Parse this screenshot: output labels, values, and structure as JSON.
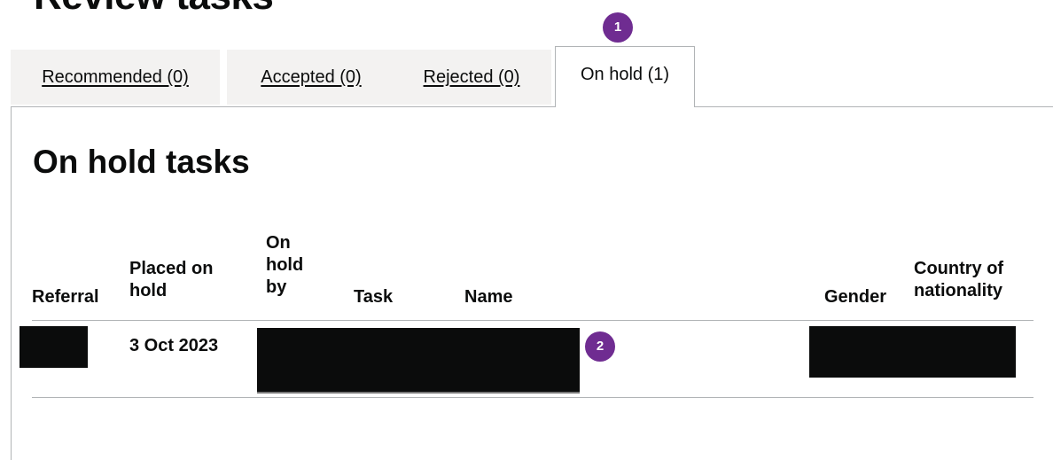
{
  "page": {
    "heading": "Review tasks"
  },
  "tabs": [
    {
      "label": "Recommended (0)",
      "selected": false
    },
    {
      "label": "Accepted (0)",
      "selected": false
    },
    {
      "label": "Rejected (0)",
      "selected": false
    },
    {
      "label": "On hold (1)",
      "selected": true
    }
  ],
  "callouts": {
    "one": "1",
    "two": "2"
  },
  "panel": {
    "title": "On hold tasks",
    "table": {
      "headers": {
        "referral": "Referral",
        "placed_on_hold": "Placed on hold",
        "on_hold_by": "On hold by",
        "task": "Task",
        "name": "Name",
        "gender": "Gender",
        "country_of_nationality": "Country of nationality"
      },
      "rows": [
        {
          "referral": "",
          "placed_on_hold": "3 Oct 2023",
          "on_hold_by": "",
          "task": "",
          "name": "",
          "gender": "",
          "country_of_nationality": ""
        }
      ]
    }
  },
  "colors": {
    "callout": "#6f2c91",
    "tab_inactive": "#f3f2f1",
    "border": "#b1b4b6",
    "text": "#0b0c0c",
    "redaction": "#0b0c0c"
  }
}
